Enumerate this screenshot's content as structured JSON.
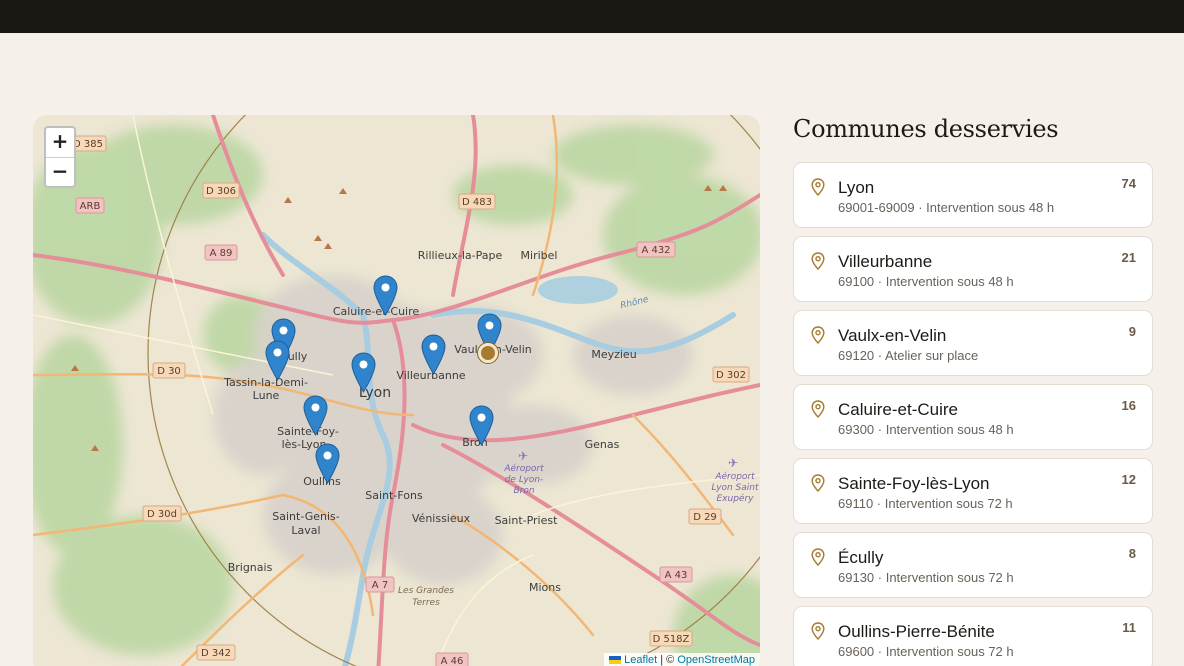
{
  "title": "Communes desservies",
  "map": {
    "zoom_in": "+",
    "zoom_out": "−",
    "attribution": {
      "leaflet": "Leaflet",
      "separator": " | © ",
      "osm": "OpenStreetMap"
    },
    "labels": {
      "lyon": "Lyon",
      "caluire": "Caluire-et-Cuire",
      "villeurbanne": "Villeurbanne",
      "vaulx": "Vaulx-en-Velin",
      "rillieux": "Rillieux-la-Pape",
      "miribel": "Miribel",
      "meyzieu": "Meyzieu",
      "bron": "Bron",
      "genas": "Genas",
      "tassin1": "Tassin-la-Demi-",
      "tassin2": "Lune",
      "ecully": "Écully",
      "sainte_foy1": "Sainte-Foy-",
      "sainte_foy2": "lès-Lyon",
      "oullins": "Oullins",
      "saint_fons": "Saint-Fons",
      "venissieux": "Vénissieux",
      "saint_priest": "Saint-Priest",
      "saint_genis1": "Saint-Genis-",
      "saint_genis2": "Laval",
      "brignais": "Brignais",
      "mions": "Mions",
      "grandes_terres1": "Les Grandes",
      "grandes_terres2": "Terres",
      "aeroport_bron1": "Aéroport",
      "aeroport_bron2": "de Lyon-",
      "aeroport_bron3": "Bron",
      "aeroport_se1": "Aéroport",
      "aeroport_se2": "Lyon Saint",
      "aeroport_se3": "Exupéry",
      "rhone": "Rhône",
      "r_d385": "D 385",
      "r_d306": "D 306",
      "r_arb": "ARB",
      "r_a89": "A 89",
      "r_d483": "D 483",
      "r_a432": "A 432",
      "r_d30": "D 30",
      "r_d302": "D 302",
      "r_d30d": "D 30d",
      "r_d29": "D 29",
      "r_a7": "A 7",
      "r_a43": "A 43",
      "r_d518z": "D 518Z",
      "r_d342": "D 342",
      "r_a46": "A 46"
    }
  },
  "communes": [
    {
      "name": "Lyon",
      "meta": "69001-69009 · Intervention sous 48 h",
      "count": "74"
    },
    {
      "name": "Villeurbanne",
      "meta": "69100 · Intervention sous 48 h",
      "count": "21"
    },
    {
      "name": "Vaulx-en-Velin",
      "meta": "69120 · Atelier sur place",
      "count": "9"
    },
    {
      "name": "Caluire-et-Cuire",
      "meta": "69300 · Intervention sous 48 h",
      "count": "16"
    },
    {
      "name": "Sainte-Foy-lès-Lyon",
      "meta": "69110 · Intervention sous 72 h",
      "count": "12"
    },
    {
      "name": "Écully",
      "meta": "69130 · Intervention sous 72 h",
      "count": "8"
    },
    {
      "name": "Oullins-Pierre-Bénite",
      "meta": "69600 · Intervention sous 72 h",
      "count": "11"
    }
  ],
  "colors": {
    "accent": "#a87a2e",
    "marker": "#2f84cc",
    "topbar": "#1b1814",
    "background": "#f6f0ea"
  }
}
